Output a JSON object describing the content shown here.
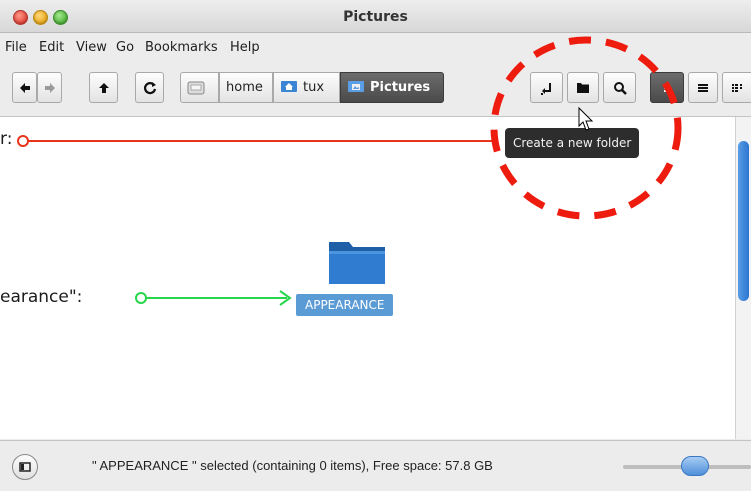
{
  "window": {
    "title": "Pictures"
  },
  "menu": [
    "File",
    "Edit",
    "View",
    "Go",
    "Bookmarks",
    "Help"
  ],
  "breadcrumb": [
    "home",
    "tux",
    "Pictures"
  ],
  "tooltip": "Create a new folder",
  "folder": {
    "name": "APPEARANCE"
  },
  "status": {
    "text": "\" APPEARANCE \" selected (containing 0 items), Free space: 57.8 GB",
    "zoom_fraction": 0.55
  },
  "annotations": {
    "left_top": "r:",
    "left_middle": "earance\":"
  },
  "colors": {
    "annotation_red": "#e8341b",
    "annotation_green": "#27d64a",
    "highlight_dashed": "#ee1c0e",
    "selection": "#5b9bd5"
  },
  "icons": {
    "back": "arrow-left-icon",
    "forward": "arrow-right-icon",
    "up": "arrow-up-icon",
    "reload": "reload-icon",
    "drive": "drive-icon",
    "home": "home-folder-icon",
    "pictures": "pictures-folder-icon",
    "open_terminal": "open-terminal-icon",
    "new_folder": "new-folder-icon",
    "search": "search-icon",
    "icon_view": "icon-view-icon",
    "list_view": "list-view-icon",
    "compact_view": "compact-view-icon"
  }
}
